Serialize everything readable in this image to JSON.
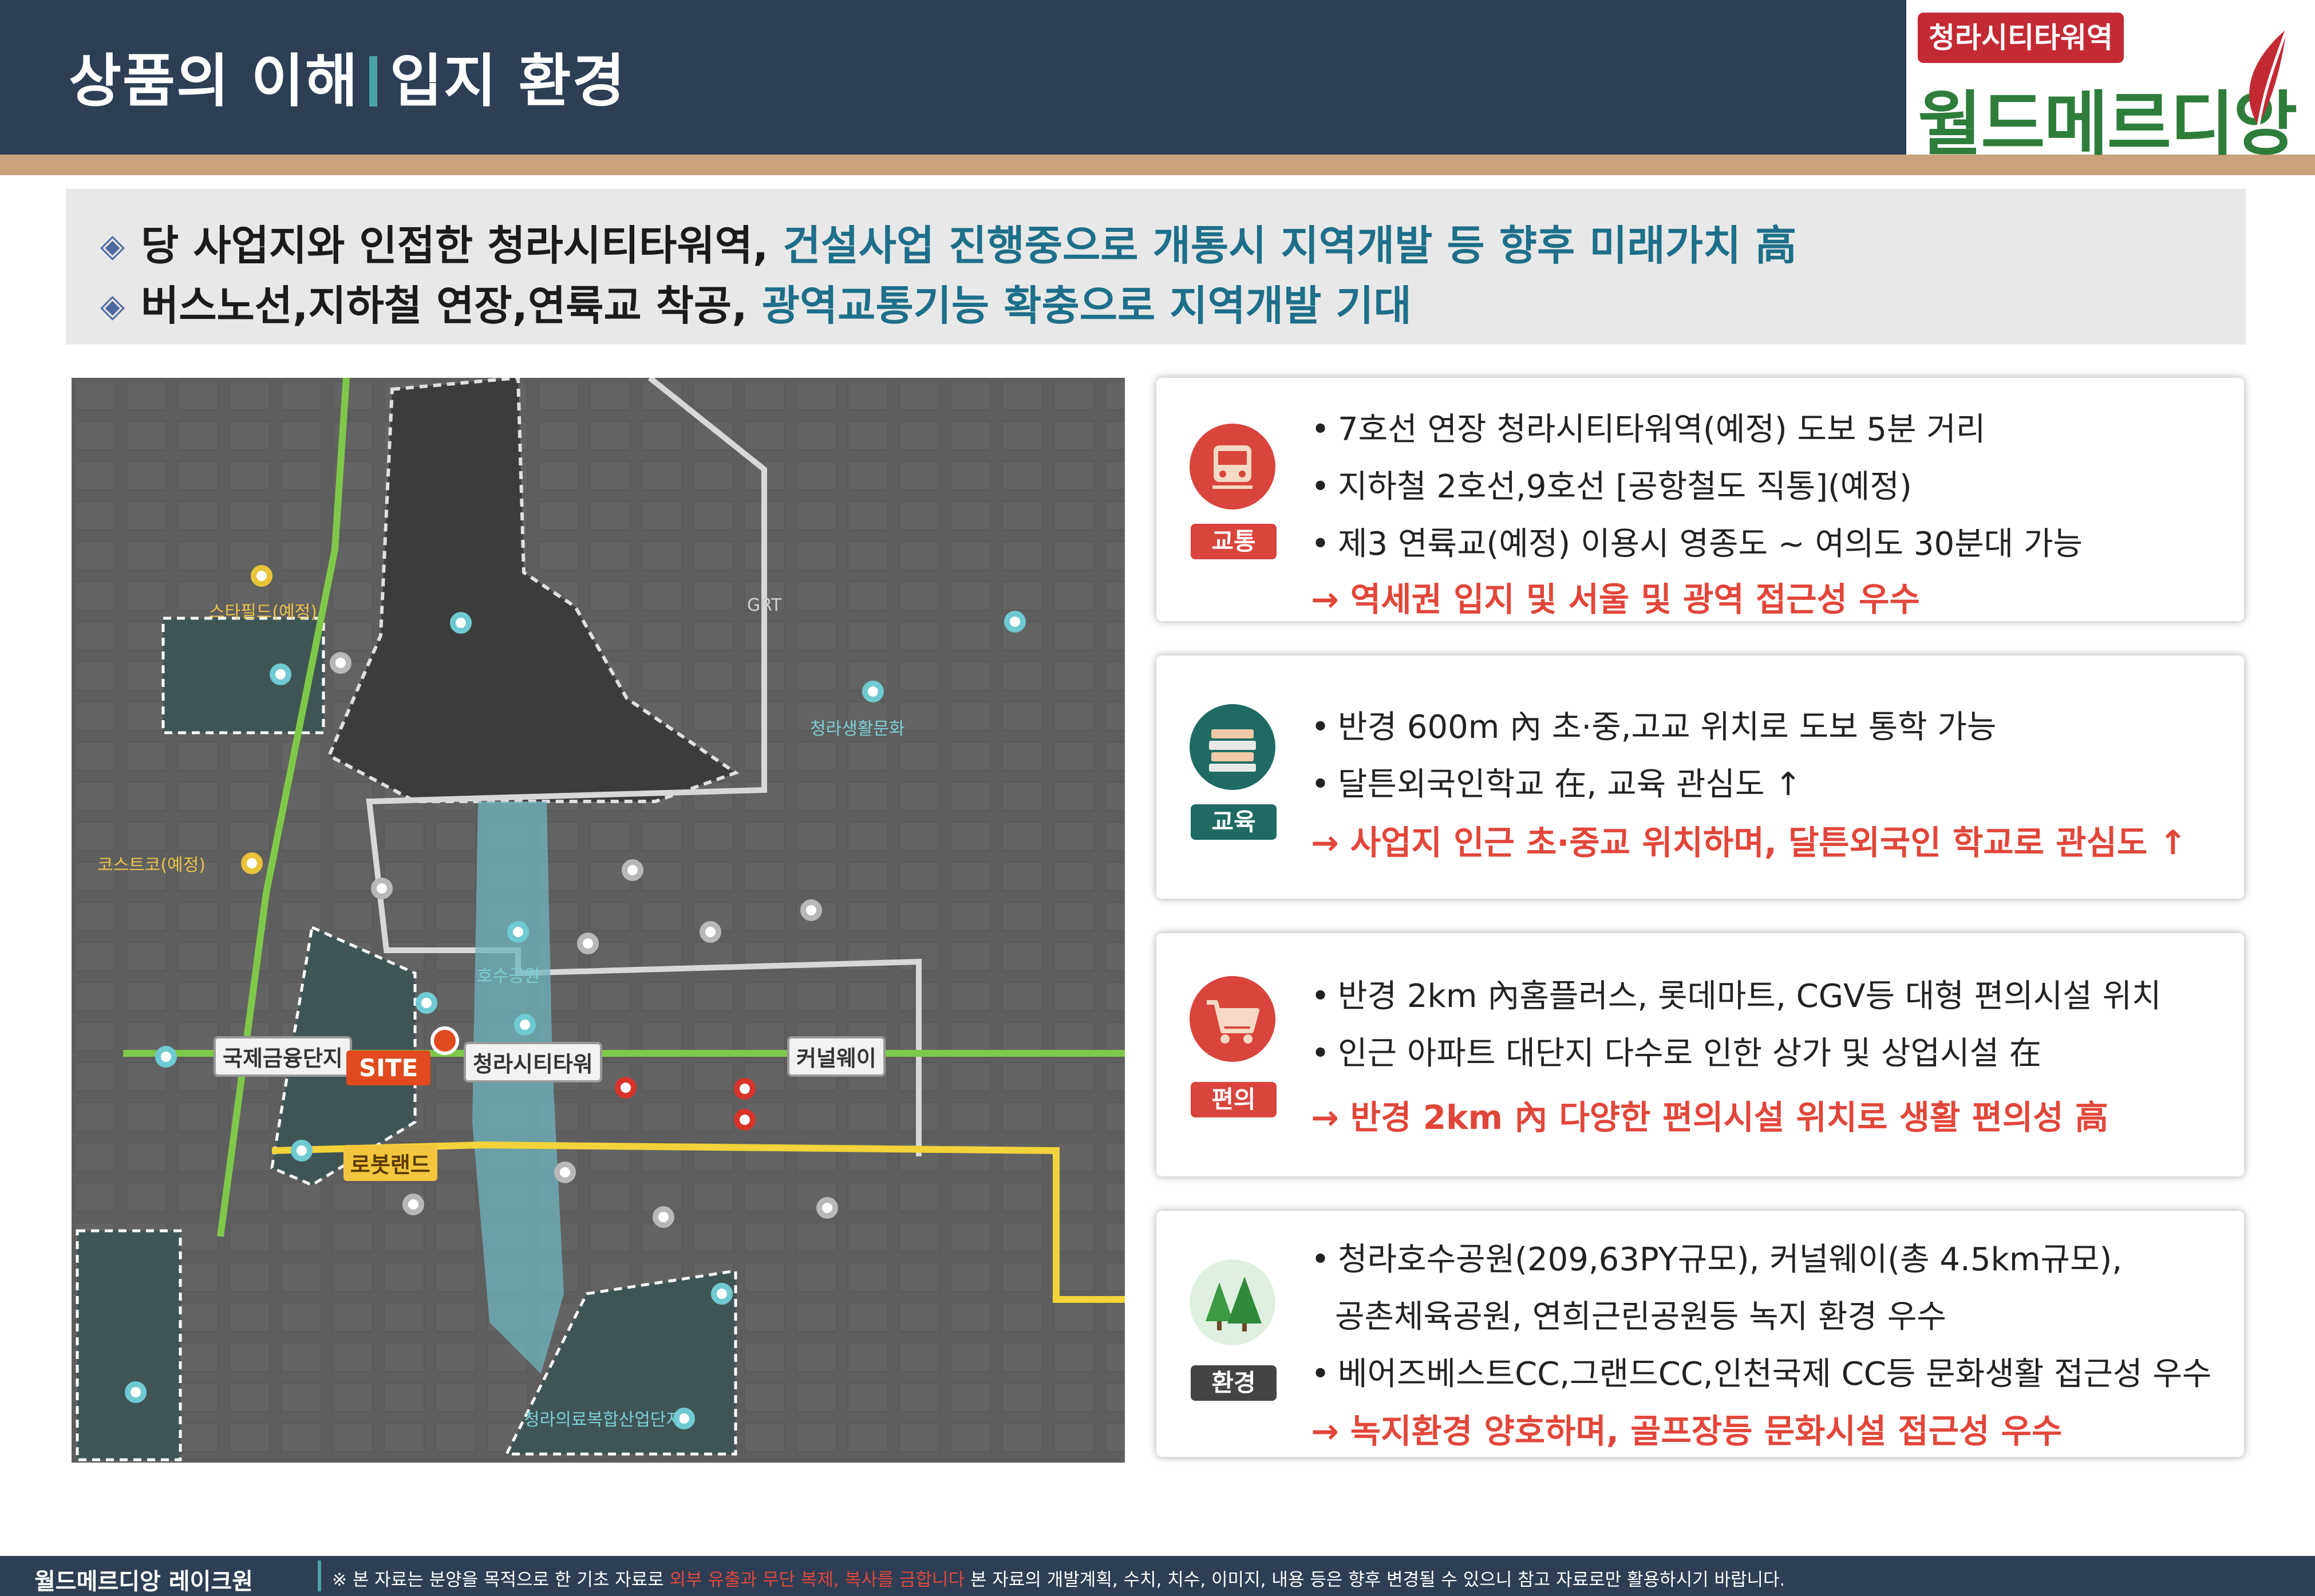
{
  "header": {
    "title_part1": "상품의 이해",
    "title_part2": "입지 환경"
  },
  "logo": {
    "badge": "청라시티타워역",
    "main": "월드메르디앙"
  },
  "summary": {
    "bullet": "◈",
    "line1_plain": "당 사업지와 인접한 청라시티타워역,",
    "line1_highlight": "건설사업 진행중으로 개통시 지역개발 등 향후 미래가치 高",
    "line2_plain": "버스노선,지하철 연장,연륙교 착공,",
    "line2_highlight": "광역교통기능 확충으로 지역개발 기대"
  },
  "map": {
    "labels": {
      "site": "SITE",
      "finance": "국제금융단지",
      "station": "청라시티타워",
      "canal": "커널웨이",
      "robot": "로봇랜드",
      "starfield": "스타필드(예정)",
      "costco": "코스트코(예정)",
      "lake": "호수공원",
      "grt": "GRT",
      "culture": "청라생활문화",
      "industrial": "청라의료복합산업단지"
    }
  },
  "cards": [
    {
      "category": "교통",
      "icon": "train-icon",
      "badge_color": "#d9443d",
      "lines": [
        "7호선 연장 청라시티타워역(예정) 도보 5분 거리",
        "지하철 2호선,9호선 [공항철도 직통](예정)",
        "제3 연륙교(예정) 이용시 영종도 ~ 여의도 30분대 가능"
      ],
      "result": "→ 역세권 입지 및 서울 및 광역 접근성 우수"
    },
    {
      "category": "교육",
      "icon": "books-icon",
      "badge_color": "#1f6b62",
      "lines": [
        "반경 600m 內 초·중,고교 위치로 도보 통학 가능",
        "달튼외국인학교 在, 교육 관심도 ↑"
      ],
      "result": "→ 사업지 인근 초·중교 위치하며, 달튼외국인 학교로 관심도 ↑"
    },
    {
      "category": "편의",
      "icon": "shopping-cart-icon",
      "badge_color": "#d9443d",
      "lines": [
        "반경 2km 內홈플러스, 롯데마트, CGV등 대형 편의시설 위치",
        "인근 아파트 대단지 다수로 인한 상가 및 상업시설 在"
      ],
      "result": "→ 반경 2km 內 다양한 편의시설 위치로 생활 편의성 高"
    },
    {
      "category": "환경",
      "icon": "trees-icon",
      "badge_color": "#444444",
      "lines": [
        "청라호수공원(209,63PY규모), 커널웨이(총 4.5km규모),",
        "공촌체육공원, 연희근린공원등 녹지 환경 우수",
        "베어즈베스트CC,그랜드CC,인천국제 CC등 문화생활 접근성 우수"
      ],
      "result": "→ 녹지환경 양호하며, 골프장등 문화시설 접근성 우수"
    }
  ],
  "footer": {
    "left": "월드메르디앙 레이크원",
    "note_prefix": "※ 본 자료는 분양을 목적으로 한 기초 자료로",
    "note_warning": "외부 유출과 무단 복제, 복사를 금합니다",
    "note_suffix": "본 자료의 개발계획, 수치, 치수, 이미지, 내용 등은 향후 변경될 수 있으니 참고 자료로만 활용하시기 바랍니다."
  }
}
